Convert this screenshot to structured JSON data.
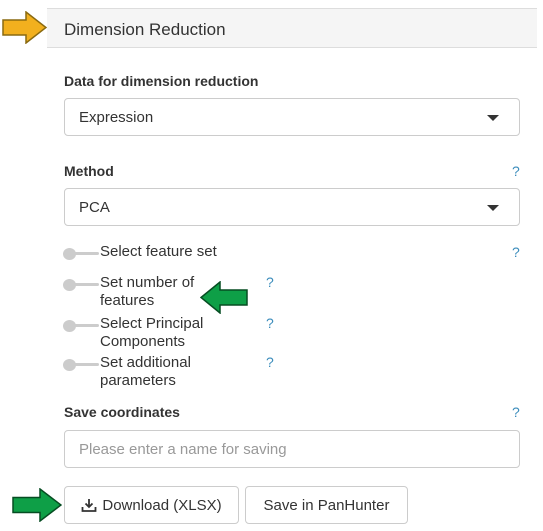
{
  "header": {
    "title": "Dimension Reduction"
  },
  "data_section": {
    "label": "Data for dimension reduction",
    "selected": "Expression"
  },
  "method_section": {
    "label": "Method",
    "help": "?",
    "selected": "PCA"
  },
  "toggles": [
    {
      "line1": "Select feature set",
      "line2": "",
      "help": "?"
    },
    {
      "line1": "Set number of",
      "line2": "features",
      "help": "?"
    },
    {
      "line1": "Select Principal",
      "line2": "Components",
      "help": "?"
    },
    {
      "line1": "Set additional",
      "line2": "parameters",
      "help": "?"
    }
  ],
  "save_section": {
    "label": "Save coordinates",
    "help": "?",
    "placeholder": "Please enter a name for saving"
  },
  "buttons": {
    "download": "Download (XLSX)",
    "panhunter": "Save in PanHunter"
  },
  "colors": {
    "header_arrow": "#f2b01e",
    "pointer_arrow": "#0e9f47",
    "help": "#3c8dbc"
  }
}
